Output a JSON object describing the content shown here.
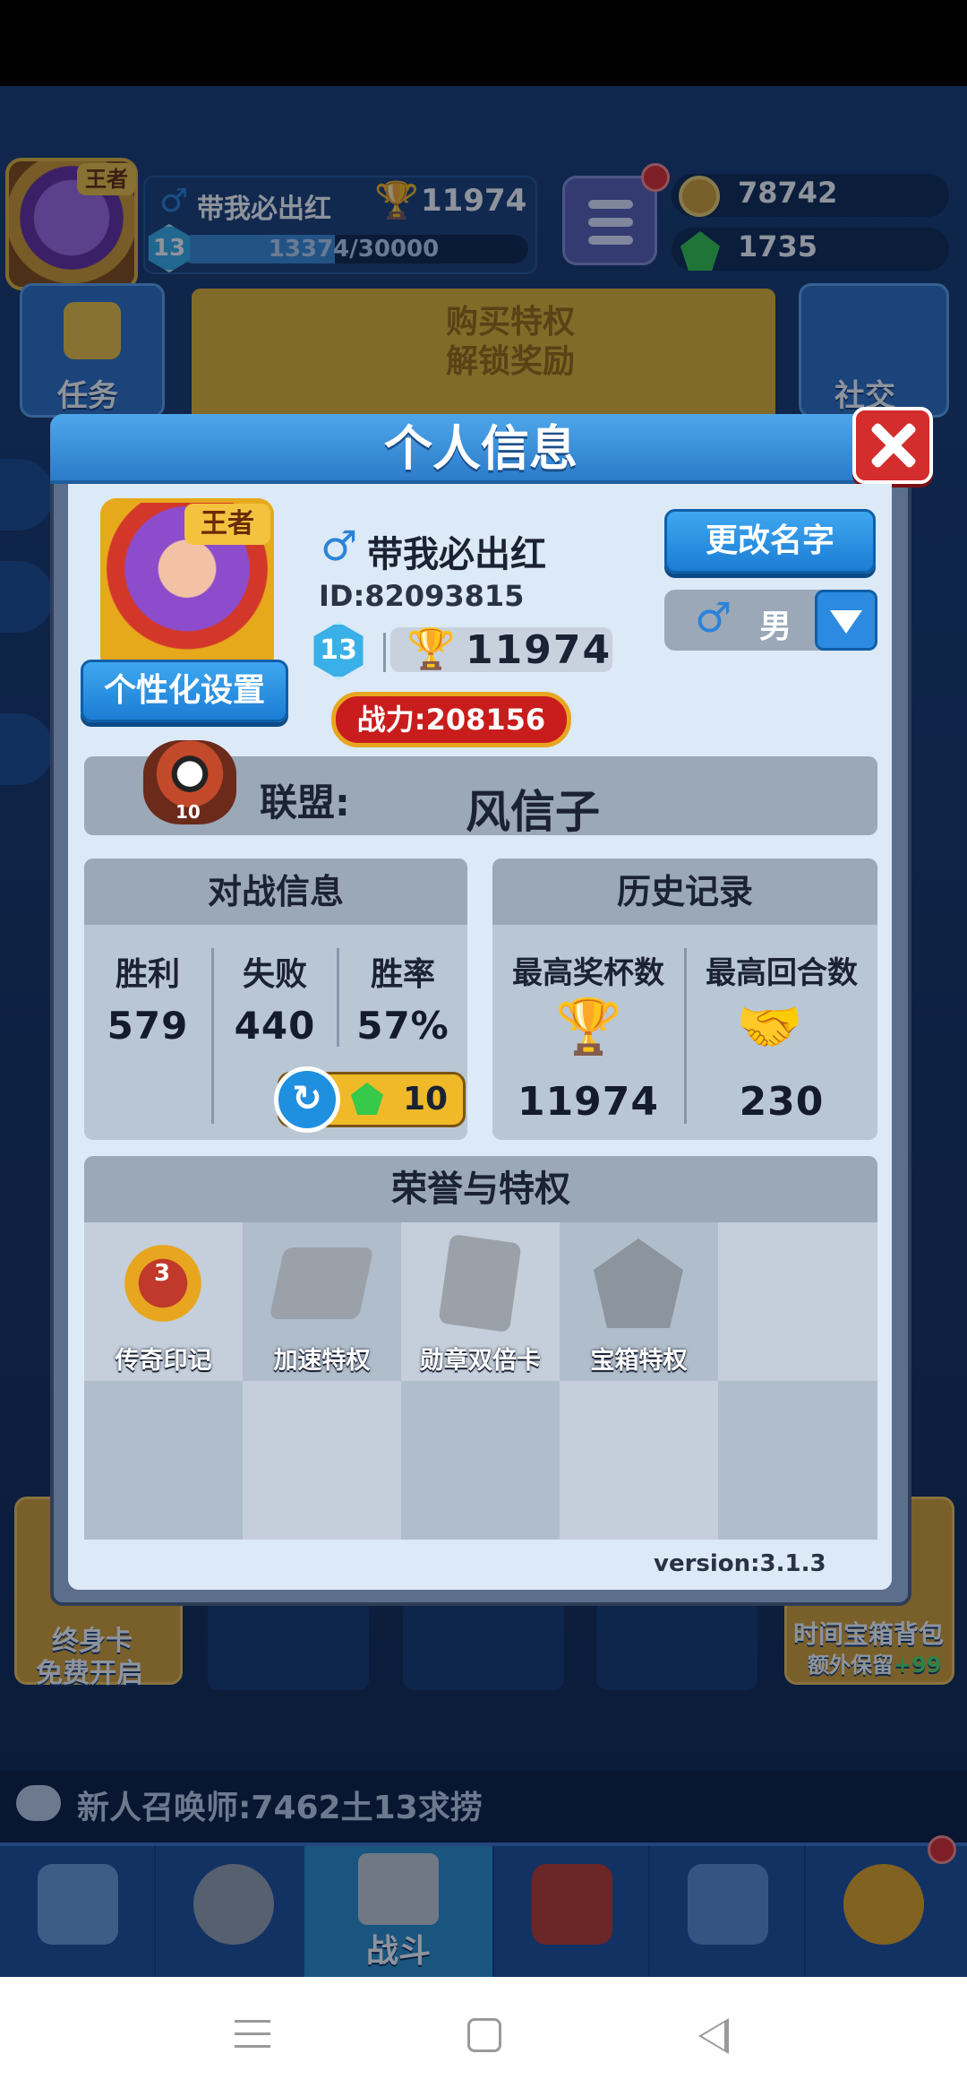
{
  "top_bar": {
    "rank_badge": "王者",
    "player_name": "带我必出红",
    "trophies": "11974",
    "level": "13",
    "xp_text": "13374/30000",
    "xp_fraction": 0.4458,
    "gold": "78742",
    "gems": "1735"
  },
  "tiles": {
    "task_label": "任务",
    "vip_line1": "购买特权",
    "vip_line2": "解锁奖励",
    "social_label": "社交",
    "left_card_line1": "终身卡",
    "left_card_line2": "免费开启",
    "right_card_line1": "时间宝箱背包",
    "right_card_line2": "额外保留",
    "right_card_bonus": "+99"
  },
  "chat": {
    "message": "新人召唤师:7462土13求捞"
  },
  "navbar": {
    "battle_label": "战斗"
  },
  "modal": {
    "title": "个人信息",
    "rank_badge": "王者",
    "customize_button": "个性化设置",
    "player_name": "带我必出红",
    "player_id": "ID:82093815",
    "level": "13",
    "trophies": "11974",
    "power": "战力:208156",
    "rename_button": "更改名字",
    "gender": "男",
    "alliance_label": "联盟:",
    "alliance_name": "风信子",
    "alliance_level": "10",
    "battle_info": {
      "title": "对战信息",
      "wins_label": "胜利",
      "wins": "579",
      "losses_label": "失败",
      "losses": "440",
      "rate_label": "胜率",
      "rate": "57%",
      "refresh_cost": "10"
    },
    "history": {
      "title": "历史记录",
      "max_trophies_label": "最高奖杯数",
      "max_trophies": "11974",
      "max_rounds_label": "最高回合数",
      "max_rounds": "230"
    },
    "honors": {
      "title": "荣誉与特权",
      "items": [
        {
          "label": "传奇印记",
          "badge": "3",
          "icon": "legend-mark-icon"
        },
        {
          "label": "加速特权",
          "icon": "speed-privilege-icon"
        },
        {
          "label": "勋章双倍卡",
          "icon": "medal-double-card-icon"
        },
        {
          "label": "宝箱特权",
          "icon": "chest-privilege-icon"
        }
      ]
    },
    "version": "version:3.1.3"
  },
  "colors": {
    "modal_header": "#2b7bc9",
    "modal_body": "#dce9f6",
    "panel": "#b9c6d4",
    "accent_gold": "#f0b928",
    "close_red": "#d42d2d"
  }
}
